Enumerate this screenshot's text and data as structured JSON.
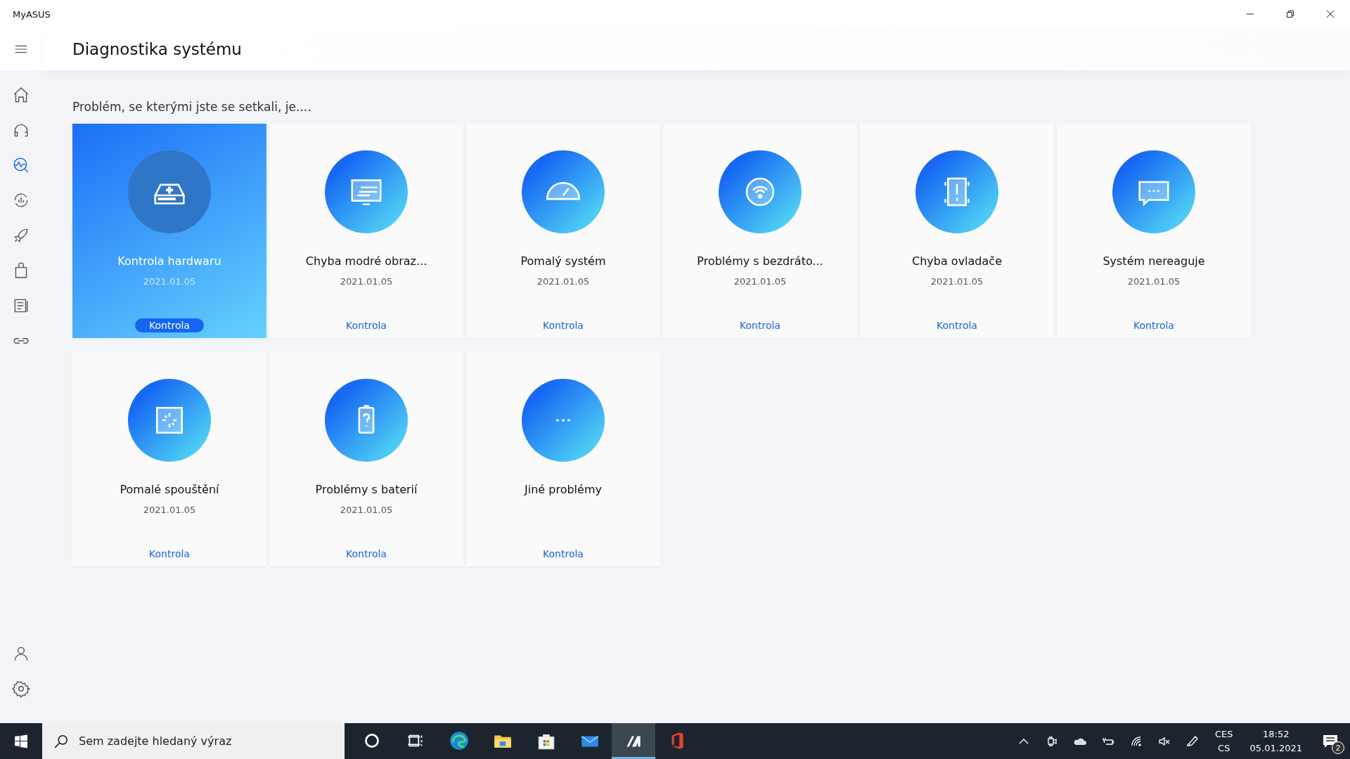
{
  "window": {
    "title": "MyASUS"
  },
  "sidebar": {
    "items": [
      {
        "kind": "home",
        "selected": false
      },
      {
        "kind": "headset",
        "selected": false
      },
      {
        "kind": "diagnostics",
        "selected": true
      },
      {
        "kind": "update",
        "selected": false
      },
      {
        "kind": "rocket",
        "selected": false
      },
      {
        "kind": "bag",
        "selected": false
      },
      {
        "kind": "document",
        "selected": false
      },
      {
        "kind": "link",
        "selected": false
      }
    ],
    "bottom_items": [
      {
        "kind": "user"
      },
      {
        "kind": "settings"
      }
    ]
  },
  "page": {
    "title": "Diagnostika systému",
    "subtitle": "Problém, se kterými jste se setkali, je...."
  },
  "cards": [
    {
      "kind": "drive",
      "title": "Kontrola hardwaru",
      "date": "2021.01.05",
      "button": "Kontrola",
      "selected": true
    },
    {
      "kind": "monitor",
      "title": "Chyba modré obraz...",
      "date": "2021.01.05",
      "button": "Kontrola",
      "selected": false
    },
    {
      "kind": "gauge",
      "title": "Pomalý systém",
      "date": "2021.01.05",
      "button": "Kontrola",
      "selected": false
    },
    {
      "kind": "wifi",
      "title": "Problémy s bezdráto...",
      "date": "2021.01.05",
      "button": "Kontrola",
      "selected": false
    },
    {
      "kind": "chip",
      "title": "Chyba ovladače",
      "date": "2021.01.05",
      "button": "Kontrola",
      "selected": false
    },
    {
      "kind": "message",
      "title": "Systém nereaguje",
      "date": "2021.01.05",
      "button": "Kontrola",
      "selected": false
    },
    {
      "kind": "loading",
      "title": "Pomalé spouštění",
      "date": "2021.01.05",
      "button": "Kontrola",
      "selected": false
    },
    {
      "kind": "battery",
      "title": "Problémy s baterií",
      "date": "2021.01.05",
      "button": "Kontrola",
      "selected": false
    },
    {
      "kind": "dots",
      "title": "Jiné problémy",
      "button": "Kontrola",
      "selected": false
    }
  ],
  "taskbar": {
    "search": {
      "placeholder": "Sem zadejte hledaný výraz"
    },
    "apps": [
      {
        "kind": "cortana",
        "selected": false
      },
      {
        "kind": "taskview",
        "selected": false
      },
      {
        "kind": "edge",
        "selected": false
      },
      {
        "kind": "explorer",
        "selected": false
      },
      {
        "kind": "store",
        "selected": false
      },
      {
        "kind": "mail",
        "selected": false
      },
      {
        "kind": "myasus",
        "selected": true
      },
      {
        "kind": "office",
        "selected": false
      }
    ],
    "tray": [
      {
        "kind": "chevron"
      },
      {
        "kind": "camera"
      },
      {
        "kind": "cloud"
      },
      {
        "kind": "power"
      },
      {
        "kind": "wifi"
      },
      {
        "kind": "mute"
      },
      {
        "kind": "pen"
      }
    ],
    "language": [
      "CES",
      "CS"
    ],
    "time": "18:52",
    "date": "05.01.2021",
    "notifications": "2"
  }
}
